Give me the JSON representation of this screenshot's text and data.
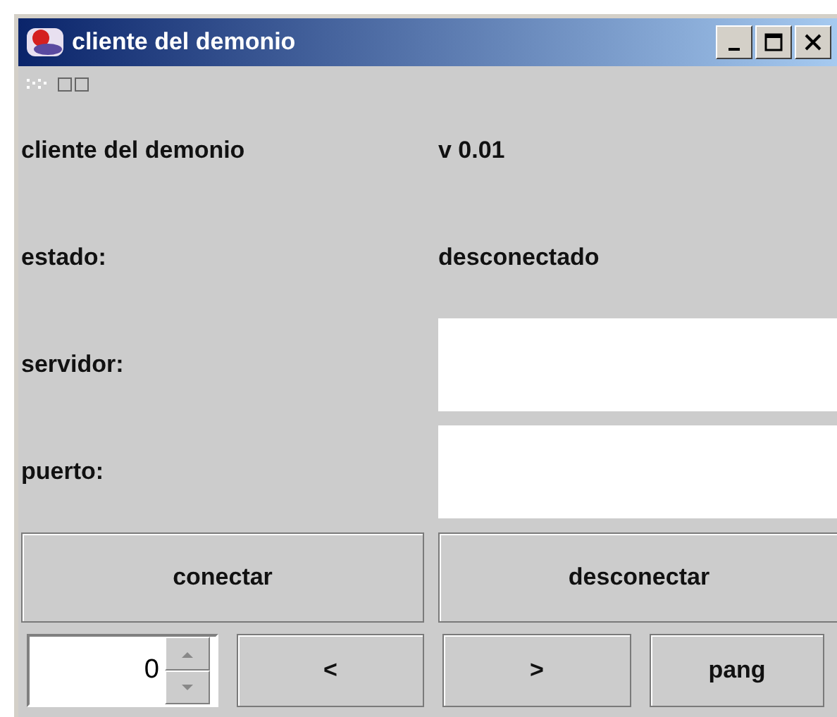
{
  "window": {
    "title": "cliente del demonio"
  },
  "rows": [
    {
      "kind": "text",
      "label": "cliente del demonio",
      "value": "v 0.01"
    },
    {
      "kind": "text",
      "label": "estado:",
      "value": "desconectado"
    },
    {
      "kind": "field",
      "label": "servidor:"
    },
    {
      "kind": "field",
      "label": "puerto:"
    }
  ],
  "buttons": [
    "conectar",
    "desconectar"
  ],
  "spinner": {
    "value": "0"
  },
  "bottom_buttons": [
    "<",
    ">",
    "pang"
  ]
}
